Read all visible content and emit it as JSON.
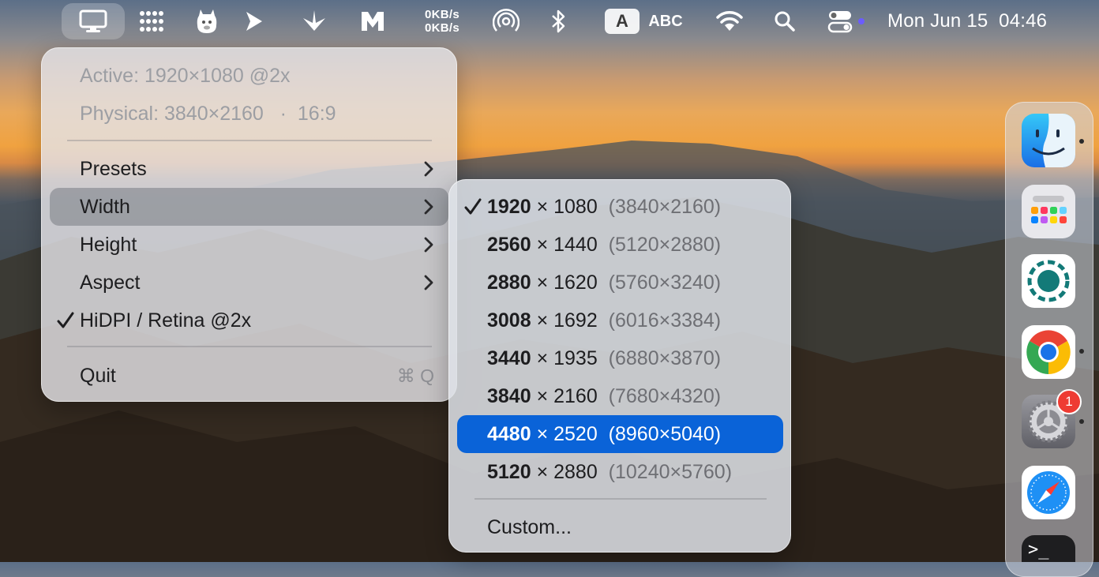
{
  "menubar": {
    "network": {
      "upload": "0KB/s",
      "download": "0KB/s"
    },
    "input_source_letter": "A",
    "input_source_name": "ABC",
    "clock": "Mon Jun 15  04:46",
    "icons": [
      "display-icon",
      "launchpad-dots-icon",
      "alpaca-icon",
      "prompt-arrow-icon",
      "butterfly-icon",
      "m-logo-icon",
      "airdrop-icon",
      "bluetooth-icon",
      "wifi-icon",
      "search-icon",
      "control-center-icon"
    ]
  },
  "main_menu": {
    "active": "Active: 1920×1080 @2x",
    "physical": "Physical: 3840×2160",
    "physical_sep": "·",
    "aspect_ratio": "16:9",
    "items": [
      {
        "label": "Presets",
        "submenu": true
      },
      {
        "label": "Width",
        "submenu": true,
        "highlighted": true
      },
      {
        "label": "Height",
        "submenu": true
      },
      {
        "label": "Aspect",
        "submenu": true
      },
      {
        "label": "HiDPI / Retina @2x",
        "checked": true
      }
    ],
    "quit": {
      "label": "Quit",
      "shortcut": "⌘ Q"
    }
  },
  "width_submenu": {
    "items": [
      {
        "w": "1920",
        "h": "× 1080",
        "phys": "(3840×2160)",
        "checked": true
      },
      {
        "w": "2560",
        "h": "× 1440",
        "phys": "(5120×2880)"
      },
      {
        "w": "2880",
        "h": "× 1620",
        "phys": "(5760×3240)"
      },
      {
        "w": "3008",
        "h": "× 1692",
        "phys": "(6016×3384)"
      },
      {
        "w": "3440",
        "h": "× 1935",
        "phys": "(6880×3870)"
      },
      {
        "w": "3840",
        "h": "× 2160",
        "phys": "(7680×4320)"
      },
      {
        "w": "4480",
        "h": "× 2520",
        "phys": "(8960×5040)",
        "selected": true
      },
      {
        "w": "5120",
        "h": "× 2880",
        "phys": "(10240×5760)"
      }
    ],
    "custom": "Custom..."
  },
  "dock": {
    "apps": [
      "finder-icon",
      "launchpad-icon",
      "screen-record-icon",
      "chrome-icon",
      "system-settings-icon",
      "safari-icon",
      "terminal-icon"
    ],
    "settings_badge": "1",
    "terminal_prompt": ">_"
  },
  "colors": {
    "selection": "#0a63d8",
    "badge": "#ee3b33",
    "status_dot": "#6b5cff"
  }
}
